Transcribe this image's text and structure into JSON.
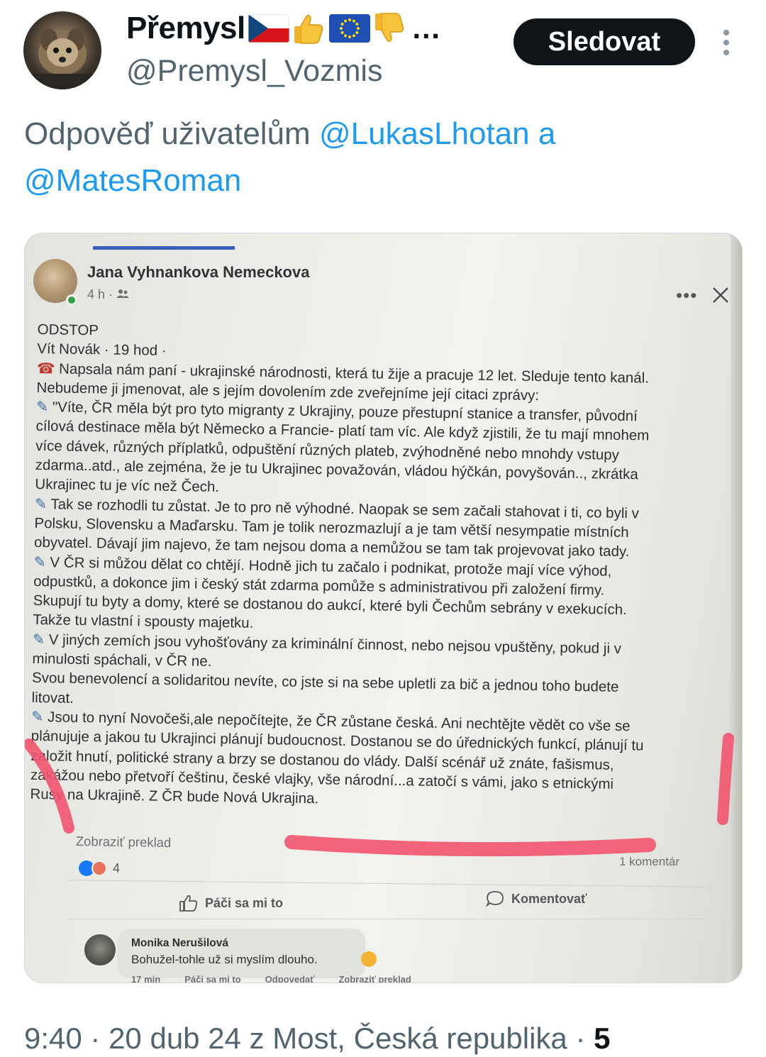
{
  "author": {
    "display_name": "Přemysl",
    "handle": "@Premysl_Vozmis",
    "name_emoji_icons": [
      "czech-flag-icon",
      "thumbs-up-icon",
      "eu-flag-icon",
      "thumbs-down-icon"
    ],
    "name_truncation": "…"
  },
  "follow_button": {
    "label": "Sledovat"
  },
  "reply_to": {
    "prefix": "Odpověď uživatelům",
    "mention1": "@LukasLhotan",
    "conjunction": "a",
    "mention2": "@MatesRoman"
  },
  "photo": {
    "author": "Jana Vyhnankova Nemeckova",
    "meta": "4 h · ",
    "body_lines": [
      "ODSTOP",
      "Vít Novák  · 19 hod  ·",
      "Napsala nám paní - ukrajinské národnosti, která tu žije a pracuje 12 let. Sleduje tento kanál.",
      "Nebudeme ji jmenovat, ale s jejím dovolením zde zveřejníme její citaci zprávy:",
      "\"Víte, ČR měla být pro tyto migranty z Ukrajiny, pouze přestupní stanice a transfer, původní",
      "cílová destinace měla být Německo a Francie- platí tam víc. Ale když zjistili, že tu mají mnohem",
      "více dávek, různých příplatků, odpuštění různých plateb, zvýhodněné nebo mnohdy vstupy",
      "zdarma..atd., ale zejména, že je tu Ukrajinec považován, vládou hýčkán, povyšován.., zkrátka",
      "Ukrajinec tu je víc než Čech.",
      "Tak se rozhodli tu zůstat. Je to pro ně výhodné. Naopak se sem začali stahovat i ti, co byli v",
      "Polsku, Slovensku a Maďarsku. Tam je tolik nerozmazlují a je tam větší nesympatie místních",
      "obyvatel. Dávají jim najevo, že tam nejsou doma a nemůžou se tam tak projevovat jako tady.",
      "V ČR si můžou dělat co chtějí.  Hodně jich tu začalo i podnikat, protože mají více výhod,",
      "odpustků, a dokonce jim i český stát zdarma pomůže s administrativou při založení firmy.",
      "Skupují tu byty a domy, které se dostanou do aukcí, které byli Čechům sebrány v exekucích.",
      "Takže tu vlastní i spousty majetku.",
      "V jiných zemích jsou vyhošťovány za kriminální činnost, nebo nejsou vpuštěny, pokud ji v",
      "minulosti spáchali, v ČR ne.",
      "Svou benevolencí a solidaritou nevíte, co jste si na sebe upletli za bič a jednou toho budete",
      "litovat.",
      "Jsou to nyní Novočeši,ale nepočítejte, že ČR zůstane česká. Ani nechtějte vědět co vše se",
      "plánujuje a jakou tu Ukrajinci plánují budoucnost. Dostanou se do úřednických funkcí, plánují tu",
      "založit hnutí, politické strany a brzy se dostanou do vlády. Další scénář už znáte, fašismus,",
      "zakážou nebo přetvoří češtinu, české vlajky, vše národní...a zatočí s vámi, jako s etnickými",
      "Rusy na Ukrajině. Z ČR bude Nová Ukrajina."
    ],
    "line_icons": [
      "",
      "",
      "phone-icon",
      "",
      "pen-icon",
      "",
      "",
      "",
      "",
      "pen-icon",
      "",
      "",
      "pen-icon",
      "",
      "",
      "",
      "pen-icon",
      "",
      "",
      "",
      "pen-icon",
      "",
      "",
      "",
      ""
    ],
    "translate": "Zobraziť preklad",
    "reaction_count": "4",
    "comments_count": "1 komentár",
    "like_label": "Páči sa mi to",
    "comment_label": "Komentovať",
    "comment": {
      "name": "Monika Nerušilová",
      "text": "Bohužel-tohle už si myslím dlouho.",
      "actions": [
        "17 min",
        "Páči sa mi to",
        "Odpovedať",
        "Zobraziť preklad"
      ]
    }
  },
  "footer": {
    "time": "9:40",
    "date": "20 dub 24",
    "location": "z Most, Česká republika",
    "views": "5"
  },
  "colors": {
    "link": "#1d9bf0",
    "secondary_text": "#536471",
    "follow_bg": "#0f1419",
    "highlight_marker": "#f2546e"
  }
}
